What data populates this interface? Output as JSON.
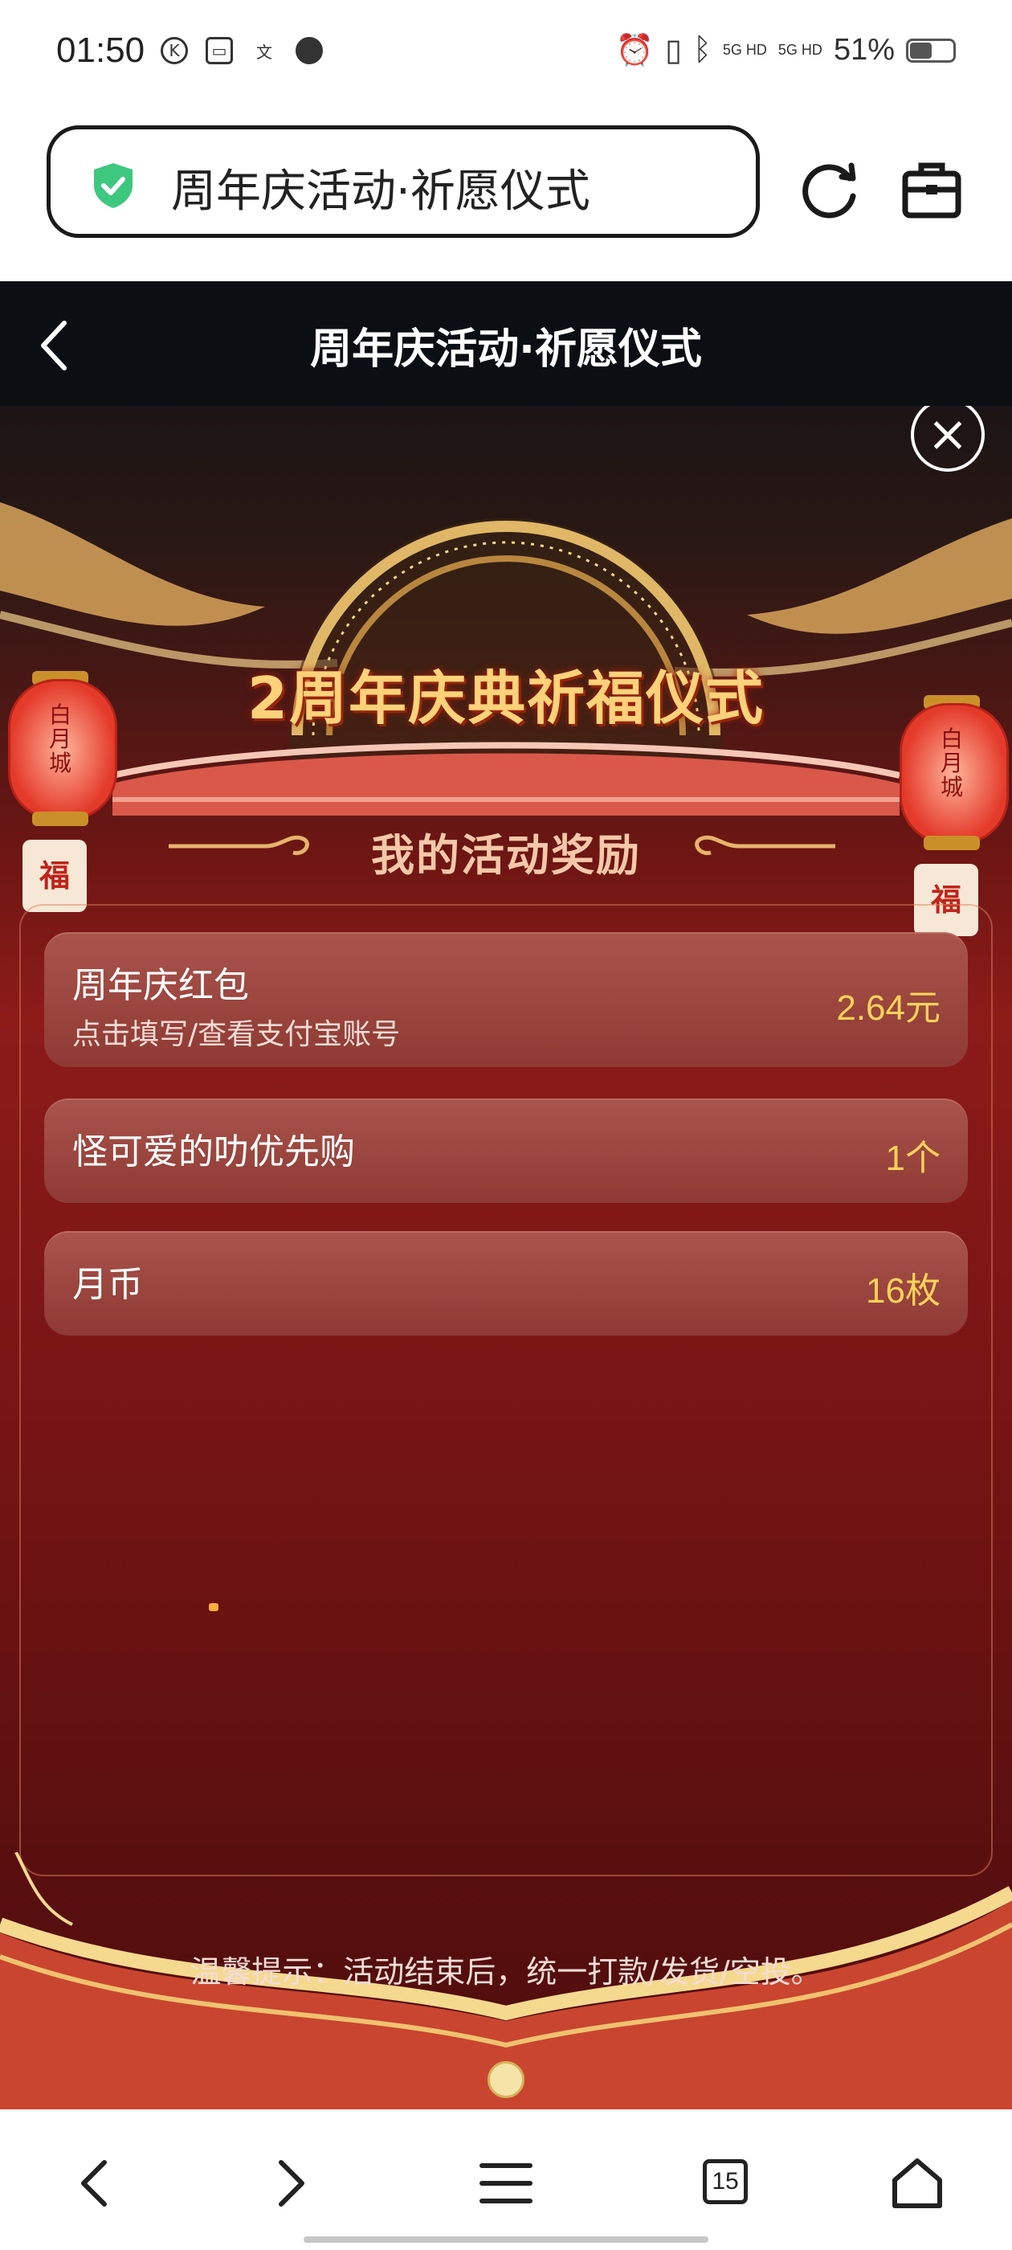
{
  "status_bar": {
    "time": "01:50",
    "network_1": "5G HD",
    "network_2": "5G HD",
    "battery": "51%",
    "battery_level": 0.51
  },
  "browser": {
    "url_title": "周年庆活动·祈愿仪式",
    "tabs_count": "15"
  },
  "header": {
    "title": "周年庆活动·祈愿仪式"
  },
  "banner": {
    "festival_title": "2周年庆典祈福仪式",
    "lantern_text": "白月城",
    "fu": "福"
  },
  "section": {
    "heading": "我的活动奖励"
  },
  "rewards": [
    {
      "name": "周年庆红包",
      "sub": "点击填写/查看支付宝账号",
      "value": "2.64元"
    },
    {
      "name": "怪可爱的叻优先购",
      "value": "1个"
    },
    {
      "name": "月币",
      "value": "16枚"
    }
  ],
  "tip": "温馨提示：活动结束后，统一打款/发货/空投。",
  "colors": {
    "accent_gold": "#ffd25a",
    "card_bg": "#9e4840",
    "page_red": "#7a1515",
    "header_bg": "#0b0f14"
  }
}
